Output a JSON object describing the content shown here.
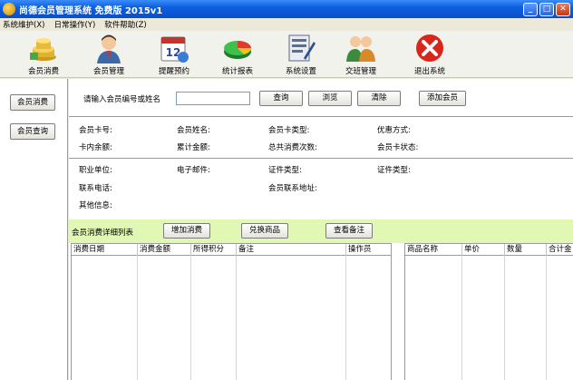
{
  "window": {
    "title": "尚德会员管理系统 免费版 2015v1",
    "min_glyph": "_",
    "max_glyph": "□",
    "close_glyph": "✕"
  },
  "menu": [
    "系统维护(X)",
    "日常操作(Y)",
    "软件帮助(Z)"
  ],
  "toolbar": [
    {
      "label": "会员消费",
      "icon": "coins-icon"
    },
    {
      "label": "会员管理",
      "icon": "member-icon"
    },
    {
      "label": "提醒预约",
      "icon": "calendar-icon"
    },
    {
      "label": "统计报表",
      "icon": "pie-chart-icon"
    },
    {
      "label": "系统设置",
      "icon": "settings-icon"
    },
    {
      "label": "交班管理",
      "icon": "shift-users-icon"
    },
    {
      "label": "退出系统",
      "icon": "exit-icon"
    }
  ],
  "calendar_day": "12",
  "sidebar": [
    "会员消费",
    "会员查询"
  ],
  "search": {
    "prompt": "请输入会员编号或姓名",
    "value": "",
    "buttons": [
      "查询",
      "浏览",
      "清除",
      "添加会员"
    ]
  },
  "member_fields": {
    "row1": [
      "会员卡号:",
      "会员姓名:",
      "会员卡类型:",
      "优惠方式:"
    ],
    "row2": [
      "卡内余额:",
      "累计金额:",
      "总共消费次数:",
      "会员卡状态:"
    ]
  },
  "extra_fields": {
    "row1": [
      "职业单位:",
      "电子邮件:",
      "证件类型:",
      "证件类型:"
    ],
    "phone": "联系电话:",
    "address": "会员联系地址:",
    "other": "其他信息:"
  },
  "detail": {
    "title": "会员消费详细列表",
    "buttons": [
      "增加消费",
      "兑换商品",
      "查看备注"
    ]
  },
  "left_table": {
    "headers": [
      "消费日期",
      "消费金额",
      "所得积分",
      "备注",
      "操作员"
    ]
  },
  "right_table": {
    "headers": [
      "商品名称",
      "单价",
      "数量",
      "合计金"
    ]
  },
  "colors": {
    "titlebar": "#0d5fe0",
    "detail_bar": "#e1f7b4"
  }
}
